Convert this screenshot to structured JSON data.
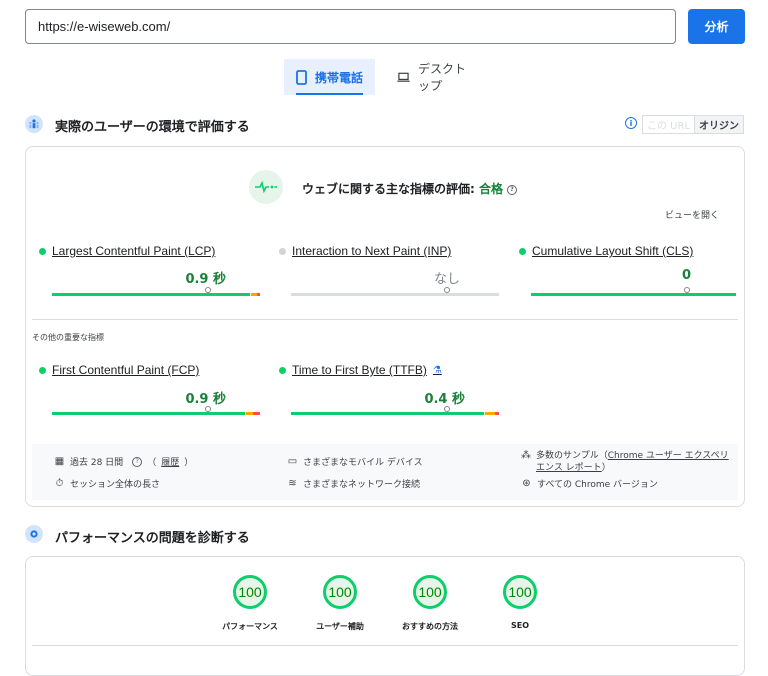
{
  "search": {
    "url": "https://e-wiseweb.com/",
    "analyze_label": "分析"
  },
  "device_tabs": {
    "mobile": "携帯電話",
    "desktop": "デスクトップ"
  },
  "field_section": {
    "title": "実際のユーザーの環境で評価する",
    "toggle": {
      "this_url": "この URL",
      "origin": "オリジン"
    },
    "assessment": {
      "prefix": "ウェブに関する主な指標の評価:",
      "result": "合格",
      "help": "?"
    },
    "expand_label": "ビューを開く",
    "core_metrics": [
      {
        "label": "Largest Contentful Paint (LCP)",
        "value": "0.9 秒",
        "status": "good",
        "p75_position": 0.75
      },
      {
        "label": "Interaction to Next Paint (INP)",
        "value": "なし",
        "status": "none",
        "p75_position": 0.75
      },
      {
        "label": "Cumulative Layout Shift (CLS)",
        "value": "0",
        "status": "good",
        "p75_position": 0.75
      }
    ],
    "other_heading": "その他の重要な指標",
    "other_metrics": [
      {
        "label": "First Contentful Paint (FCP)",
        "value": "0.9 秒",
        "status": "good",
        "p75_position": 0.75
      },
      {
        "label": "Time to First Byte (TTFB)",
        "value": "0.4 秒",
        "status": "good",
        "p75_position": 0.75
      }
    ],
    "summary": {
      "period": "過去 28 日間",
      "history_link": "履歴",
      "session": "セッション全体の長さ",
      "devices": "さまざまなモバイル デバイス",
      "network": "さまざまなネットワーク接続",
      "samples_prefix": "多数のサンプル（",
      "samples_link": "Chrome ユーザー エクスペリエンス レポート",
      "samples_suffix": "）",
      "chrome_versions": "すべての Chrome バージョン"
    }
  },
  "lab_section": {
    "title": "パフォーマンスの問題を診断する",
    "scores": [
      {
        "value": "100",
        "label": "パフォーマンス"
      },
      {
        "value": "100",
        "label": "ユーザー補助"
      },
      {
        "value": "100",
        "label": "おすすめの方法"
      },
      {
        "value": "100",
        "label": "SEO"
      }
    ]
  },
  "colors": {
    "accent": "#1a73e8",
    "good": "#0cce6b",
    "pass_text": "#188038",
    "average": "#ffa400",
    "poor": "#ff4e42"
  }
}
